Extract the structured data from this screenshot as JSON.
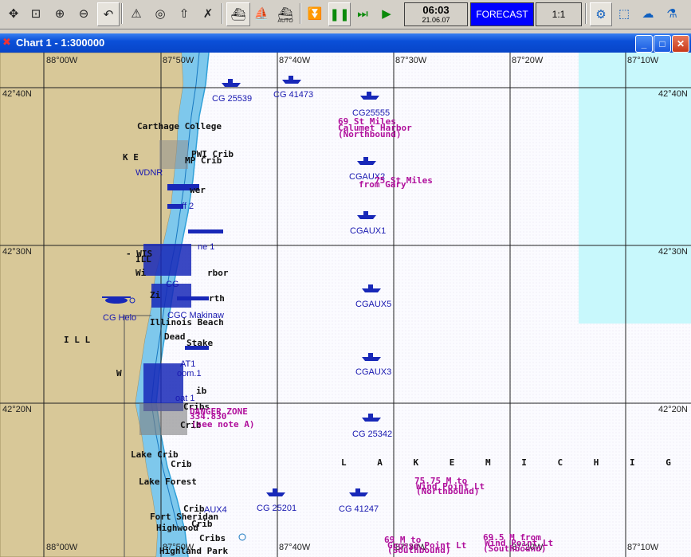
{
  "toolbar": {
    "icons": [
      "pan-icon",
      "zoom-window-icon",
      "zoom-in-icon",
      "zoom-out-icon",
      "undo-view-icon",
      "route-icon",
      "target-icon",
      "load-icon",
      "clear-icon",
      "north-up-icon",
      "track-icon",
      "auto-mode-icon",
      "step-icon",
      "pause-icon",
      "fast-forward-icon",
      "play-icon",
      "tide-icon",
      "graph-icon",
      "weather-icon",
      "current-icon"
    ],
    "auto_label": "AUTO",
    "time": "06:03",
    "date": "21.06.07",
    "forecast_label": "FORECAST",
    "scale_label": "1:1"
  },
  "window": {
    "title": "Chart 1 - 1:300000",
    "app_icon": "✖",
    "minimize": "_",
    "maximize": "□",
    "close": "✕"
  },
  "chart": {
    "longitudes_top": [
      "88°00W",
      "87°50W",
      "87°40W",
      "87°30W",
      "87°20W",
      "87°10W"
    ],
    "longitudes_bottom": [
      "88°00W",
      "87°50W",
      "87°40W",
      "87°30W",
      "87°20W",
      "87°10W"
    ],
    "latitudes_left": [
      "42°40N",
      "42°30N",
      "42°20N"
    ],
    "latitudes_right": [
      "42°40N",
      "42°30N",
      "42°20N"
    ],
    "place_labels": {
      "carthage": "Carthage College",
      "illinois_beach": "Illinois Beach",
      "lake_forest": "Lake Forest",
      "fort_sheridan": "Fort Sheridan",
      "highwood": "Highwood",
      "highland_park": "Highland Park",
      "cribs": "Cribs",
      "crib": "Crib",
      "lake_crib": "Lake Crib",
      "mp_crib": "MP Crib",
      "pwi_crib": "PWI Crib",
      "ill": "I L L",
      "kenosha_k": "K E",
      "w": "W",
      "wisc": "- WIS",
      "ill2": "ILL",
      "wi": "Wi",
      "harbor": "rbor",
      "rth": "rth",
      "zion": "Zi",
      "stake": "Stake",
      "dead": "Dead",
      "ib": "ib",
      "wer": "wer",
      "lake_michigan": "L A K E M I C H I G A N"
    },
    "vessel_labels": {
      "cg25539": "CG 25539",
      "cg41473": "CG 41473",
      "cg25555": "CG25555",
      "cgaux2": "CGAUX2",
      "cgaux1": "CGAUX1",
      "cgaux5": "CGAUX5",
      "cgaux3": "CGAUX3",
      "cg25342": "CG 25342",
      "cg25201": "CG 25201",
      "cg41247": "CG 41247",
      "cghelo": "CG Helo",
      "cgmakinaw": "CGC Makinaw",
      "aux4": "AUX4",
      "boat1": "oat 1",
      "boom1": "oom.1",
      "ff2": "ff 2",
      "ne1": "ne 1",
      "at1": "AT1",
      "wdnr": "WDNR",
      "cg2": "CG"
    },
    "route_labels": {
      "r69_miles": "69 St Miles",
      "calumet": "Calumet Harbor",
      "northbound1": "(Northbound)",
      "r75_miles": "75 St Miles",
      "from_gary": "from Gary",
      "danger_zone": "DANGER ZONE",
      "danger_num": "334.830",
      "see_note": "(see note A)",
      "r75_75": "75.75 M to",
      "wind_point": "Wind Point Lt",
      "northbound2": "(Northbound)",
      "r69_m_to": "69 M to",
      "r69_southbound": "(Southbound)",
      "grosse": "Grosse Point Lt",
      "r69_5": "69.5 M from",
      "r69_5_pt": "Wind Point Lt",
      "southbound2": "(Southbound)"
    }
  },
  "colors": {
    "land": "#d8c898",
    "water_shallow": "#7ec8ec",
    "water_deep": "#fbfbff",
    "cyan_zone": "#c8f8fc",
    "vessel": "#1828b8",
    "route_magenta": "#b0109c",
    "grid": "#202020"
  }
}
